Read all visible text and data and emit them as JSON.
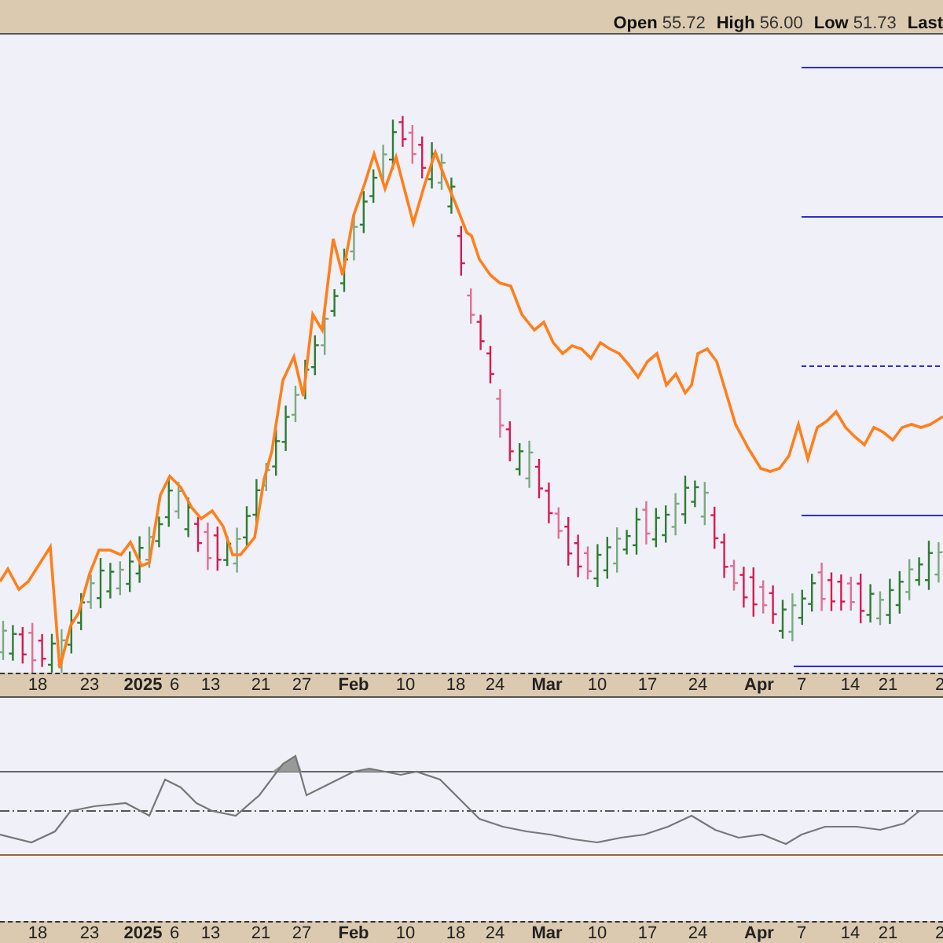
{
  "header": {
    "quote": [
      {
        "label": "Open",
        "value": "55.72"
      },
      {
        "label": "High",
        "value": "56.00"
      },
      {
        "label": "Low",
        "value": "51.73"
      },
      {
        "label": "Last"
      }
    ]
  },
  "price_axis": {
    "labels": [
      {
        "text": "18",
        "kind": "day"
      },
      {
        "text": "23",
        "kind": "day"
      },
      {
        "text": "2025",
        "kind": "year"
      },
      {
        "text": "6",
        "kind": "day"
      },
      {
        "text": "13",
        "kind": "day"
      },
      {
        "text": "21",
        "kind": "day"
      },
      {
        "text": "27",
        "kind": "day"
      },
      {
        "text": "Feb",
        "kind": "month"
      },
      {
        "text": "10",
        "kind": "day"
      },
      {
        "text": "18",
        "kind": "day"
      },
      {
        "text": "24",
        "kind": "day"
      },
      {
        "text": "Mar",
        "kind": "month"
      },
      {
        "text": "10",
        "kind": "day"
      },
      {
        "text": "17",
        "kind": "day"
      },
      {
        "text": "24",
        "kind": "day"
      },
      {
        "text": "Apr",
        "kind": "month"
      },
      {
        "text": "7",
        "kind": "day"
      },
      {
        "text": "14",
        "kind": "day"
      },
      {
        "text": "21",
        "kind": "day"
      },
      {
        "text": "2",
        "kind": "day"
      }
    ]
  },
  "oscillator_axis": {
    "labels": [
      {
        "text": "18",
        "kind": "day"
      },
      {
        "text": "23",
        "kind": "day"
      },
      {
        "text": "2025",
        "kind": "year"
      },
      {
        "text": "6",
        "kind": "day"
      },
      {
        "text": "13",
        "kind": "day"
      },
      {
        "text": "21",
        "kind": "day"
      },
      {
        "text": "27",
        "kind": "day"
      },
      {
        "text": "Feb",
        "kind": "month"
      },
      {
        "text": "10",
        "kind": "day"
      },
      {
        "text": "18",
        "kind": "day"
      },
      {
        "text": "24",
        "kind": "day"
      },
      {
        "text": "Mar",
        "kind": "month"
      },
      {
        "text": "10",
        "kind": "day"
      },
      {
        "text": "17",
        "kind": "day"
      },
      {
        "text": "24",
        "kind": "day"
      },
      {
        "text": "Apr",
        "kind": "month"
      },
      {
        "text": "7",
        "kind": "day"
      },
      {
        "text": "14",
        "kind": "day"
      },
      {
        "text": "21",
        "kind": "day"
      },
      {
        "text": "2",
        "kind": "day"
      }
    ]
  }
}
